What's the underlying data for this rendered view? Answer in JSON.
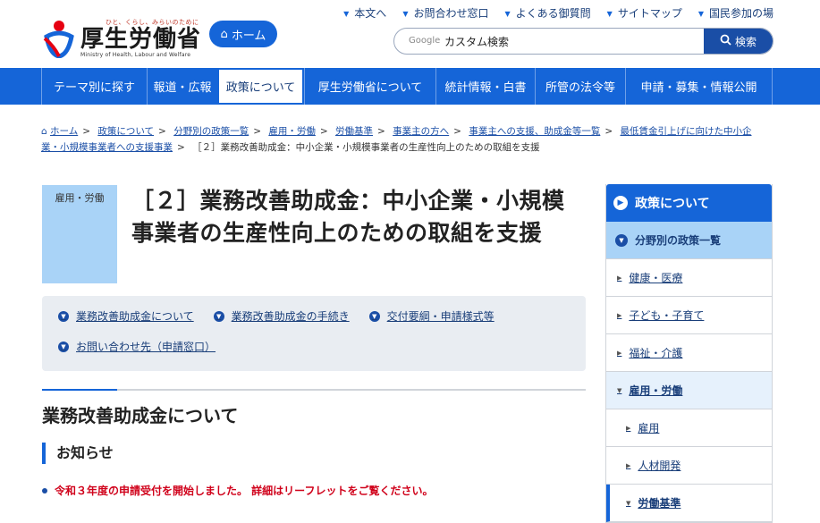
{
  "logo": {
    "tagline": "ひと、くらし、みらいのために",
    "name": "厚生労働省",
    "english": "Ministry of Health, Labour and Welfare"
  },
  "header": {
    "home_label": "ホーム",
    "util_links": [
      "本文へ",
      "お問合わせ窓口",
      "よくある御質問",
      "サイトマップ",
      "国民参加の場"
    ],
    "search_google": "Google",
    "search_value": "カスタム検索",
    "search_button": "検索"
  },
  "nav": {
    "items": [
      "テーマ別に探す",
      "報道・広報",
      "政策について",
      "厚生労働省について",
      "統計情報・白書",
      "所管の法令等",
      "申請・募集・情報公開"
    ],
    "active_index": 2
  },
  "breadcrumb": {
    "links": [
      "ホーム",
      "政策について",
      "分野別の政策一覧",
      "雇用・労働",
      "労働基準",
      "事業主の方へ",
      "事業主への支援、助成金等一覧",
      "最低賃金引上げに向けた中小企業・小規模事業者への支援事業"
    ],
    "current": "［２］業務改善助成金：中小企業・小規模事業者の生産性向上のための取組を支援"
  },
  "main": {
    "category": "雇用・労働",
    "title": "［２］業務改善助成金：中小企業・小規模事業者の生産性向上のための取組を支援",
    "anchors": [
      "業務改善助成金について",
      "業務改善助成金の手続き",
      "交付要綱・申請様式等",
      "お問い合わせ先（申請窓口）"
    ],
    "section_heading": "業務改善助成金について",
    "subheading": "お知らせ",
    "notice": "令和３年度の申請受付を開始しました。 詳細はリーフレットをご覧ください。"
  },
  "sidebar": {
    "heading": "政策について",
    "sub": "分野別の政策一覧",
    "items": [
      "健康・医療",
      "子ども・子育て",
      "福祉・介護",
      "雇用・労働",
      "雇用",
      "人材開発",
      "労働基準"
    ]
  },
  "colors": {
    "primary": "#1565d8",
    "light_blue": "#a9d3f7",
    "notice_red": "#d0021b"
  }
}
